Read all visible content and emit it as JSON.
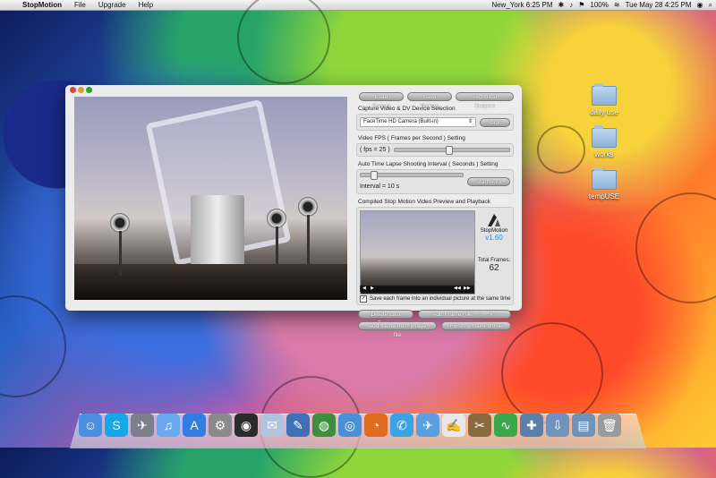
{
  "menubar": {
    "app_name": "StopMotion",
    "menus": [
      "File",
      "Upgrade",
      "Help"
    ],
    "status": {
      "location_time": "New_York 6:25 PM",
      "battery": "100%",
      "datetime": "Tue May 28  4:25 PM"
    }
  },
  "desktop_icons": [
    "daily use",
    "works",
    "tempUSE"
  ],
  "window": {
    "buttons": {
      "load_project": "Load Project",
      "save_project": "Save Project",
      "technical_support": "Technical Support",
      "select": "Select",
      "start_auto": "Start Auto",
      "delete_last_frame": "Delete Last Frame",
      "add_frame": "Add Frame  ( ⌘ + ⇧ + k )",
      "add_frame_from_file": "Add frame from image file",
      "finish_save": "Finish & Save Movie"
    },
    "capture_label": "Capture Video & DV Device Selection",
    "device_selected": "FaceTime HD Camera (Built-in)",
    "fps_label": "Video FPS ( Frames per Second ) Setting",
    "fps_value": "( fps = 25 )",
    "fps_slider_fraction": 0.45,
    "interval_label": "Auto Time Lapse Shooting Interval ( Seconds ) Setting",
    "interval_value": "Interval = 10 s",
    "interval_slider_fraction": 0.1,
    "preview_label": "Compiled Stop Motion Video Preview and Playback",
    "logo_name": "StopMotion",
    "version": "v1.60",
    "total_frames_label": "Total Frames:",
    "total_frames": "62",
    "save_each_frame": "Save each frame into an individual picture at the same time",
    "save_each_frame_checked": true
  },
  "colors": {
    "version_accent": "#2d89e0"
  },
  "dock_items": [
    "finder-icon",
    "skype-icon",
    "launchpad-icon",
    "itunes-icon",
    "app-store-icon",
    "system-preferences-icon",
    "dashboard-icon",
    "mail-icon",
    "xcode-icon",
    "google-earth-icon",
    "safari-icon",
    "firefox-icon",
    "messages-icon",
    "mail-bird-icon",
    "textedit-icon",
    "tool-icon",
    "grapher-icon",
    "utilities-icon",
    "downloads-folder-icon",
    "documents-folder-icon",
    "trash-icon"
  ]
}
